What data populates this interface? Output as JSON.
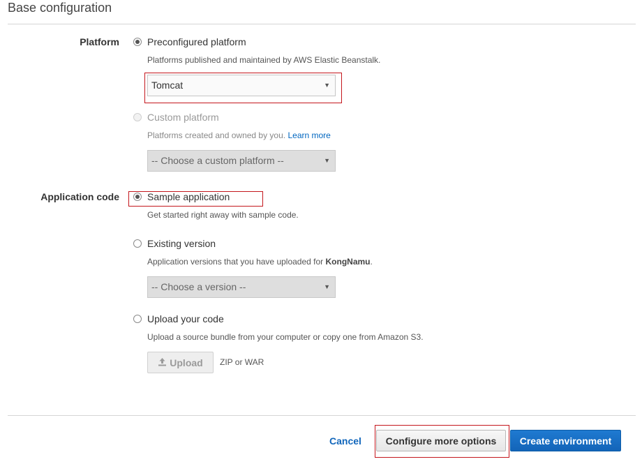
{
  "section": {
    "title": "Base configuration"
  },
  "platform": {
    "label": "Platform",
    "preconfigured": {
      "label": "Preconfigured platform",
      "description": "Platforms published and maintained by AWS Elastic Beanstalk.",
      "selected_value": "Tomcat",
      "checked": true
    },
    "custom": {
      "label": "Custom platform",
      "description": "Platforms created and owned by you.",
      "learn_more": "Learn more",
      "select_placeholder": "-- Choose a custom platform --",
      "disabled": true
    }
  },
  "application_code": {
    "label": "Application code",
    "sample": {
      "label": "Sample application",
      "description": "Get started right away with sample code.",
      "checked": true
    },
    "existing": {
      "label": "Existing version",
      "description_prefix": "Application versions that you have uploaded for ",
      "app_name": "KongNamu",
      "description_suffix": ".",
      "select_placeholder": "-- Choose a version --"
    },
    "upload": {
      "label": "Upload your code",
      "description": "Upload a source bundle from your computer or copy one from Amazon S3.",
      "button": "Upload",
      "file_types": "ZIP or WAR"
    }
  },
  "footer": {
    "cancel": "Cancel",
    "configure_more": "Configure more options",
    "create": "Create environment"
  },
  "icons": {
    "upload": "upload-icon",
    "caret": "caret-down-icon",
    "radio": "radio-icon"
  },
  "colors": {
    "highlight": "#c4161c",
    "primary": "#1a6fc4",
    "link": "#0066c0"
  }
}
